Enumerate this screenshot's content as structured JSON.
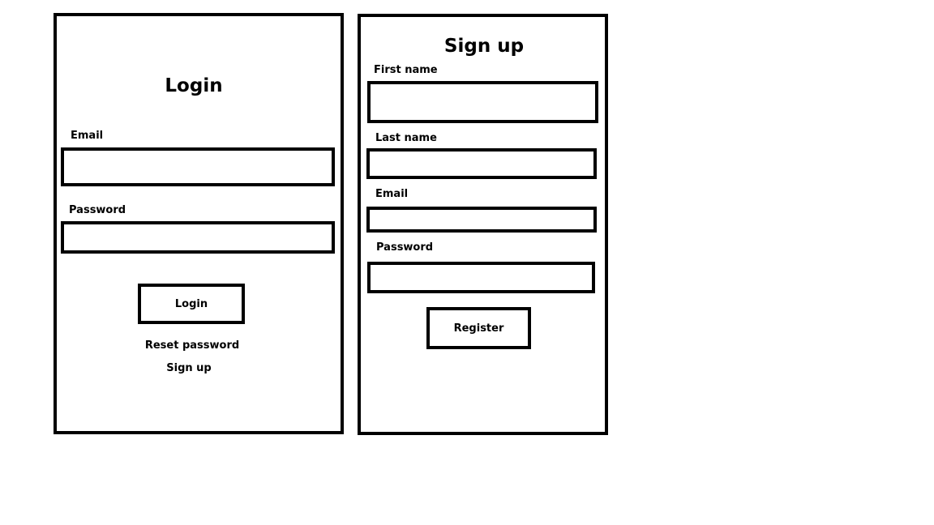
{
  "login": {
    "title": "Login",
    "email_label": "Email",
    "email_value": "",
    "password_label": "Password",
    "password_value": "",
    "login_button": "Login",
    "reset_link": "Reset password",
    "signup_link": "Sign up"
  },
  "signup": {
    "title": "Sign up",
    "first_name_label": "First name",
    "first_name_value": "",
    "last_name_label": "Last name",
    "last_name_value": "",
    "email_label": "Email",
    "email_value": "",
    "password_label": "Password",
    "password_value": "",
    "register_button": "Register"
  },
  "colors": {
    "border": "#000000",
    "background": "#ffffff",
    "text": "#000000"
  }
}
